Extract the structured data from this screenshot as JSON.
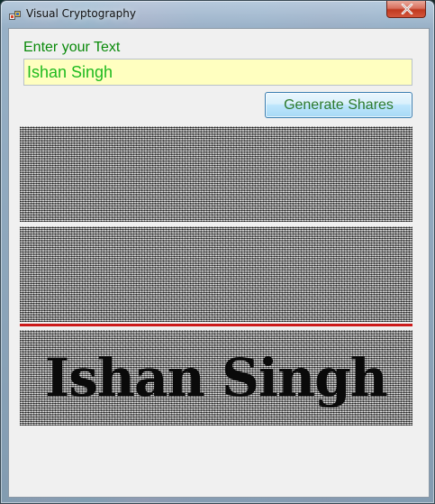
{
  "window": {
    "title": "Visual Cryptography",
    "close_icon": "close-icon",
    "app_icon": "app-icon"
  },
  "form": {
    "prompt_label": "Enter your Text",
    "text_value": "Ishan Singh",
    "generate_button": "Generate Shares"
  },
  "shares": {
    "overlay_text": "Ishan Singh"
  },
  "colors": {
    "prompt": "#0a8a0a",
    "input_background": "#ffffc0",
    "input_text": "#1fbb1f",
    "divider": "#cc1a1a"
  }
}
